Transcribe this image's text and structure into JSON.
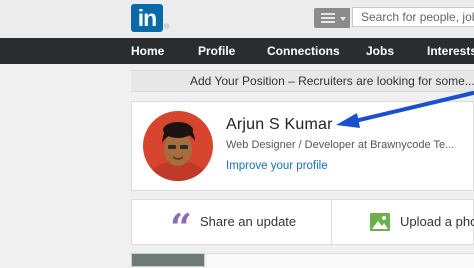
{
  "header": {
    "logo_text": "in",
    "logo_mark": "®",
    "search_placeholder": "Search for people, jobs, companies, and more...",
    "search_category_icon": "list-icon",
    "brand_color": "#0a6aa8"
  },
  "nav": {
    "items": [
      {
        "label": "Home"
      },
      {
        "label": "Profile"
      },
      {
        "label": "Connections"
      },
      {
        "label": "Jobs"
      },
      {
        "label": "Interests"
      }
    ]
  },
  "banner": {
    "text": "Add Your Position – Recruiters are looking for some..."
  },
  "profile": {
    "name": "Arjun S Kumar",
    "headline": "Web Designer / Developer at Brawnycode Te...",
    "improve_link": "Improve your profile",
    "link_color": "#1474b8",
    "annotation_arrow_color": "#1a4fd0"
  },
  "share": {
    "update_label": "Share an update",
    "photo_label": "Upload a photo",
    "update_icon": "quote-icon",
    "photo_icon": "photo-icon"
  }
}
